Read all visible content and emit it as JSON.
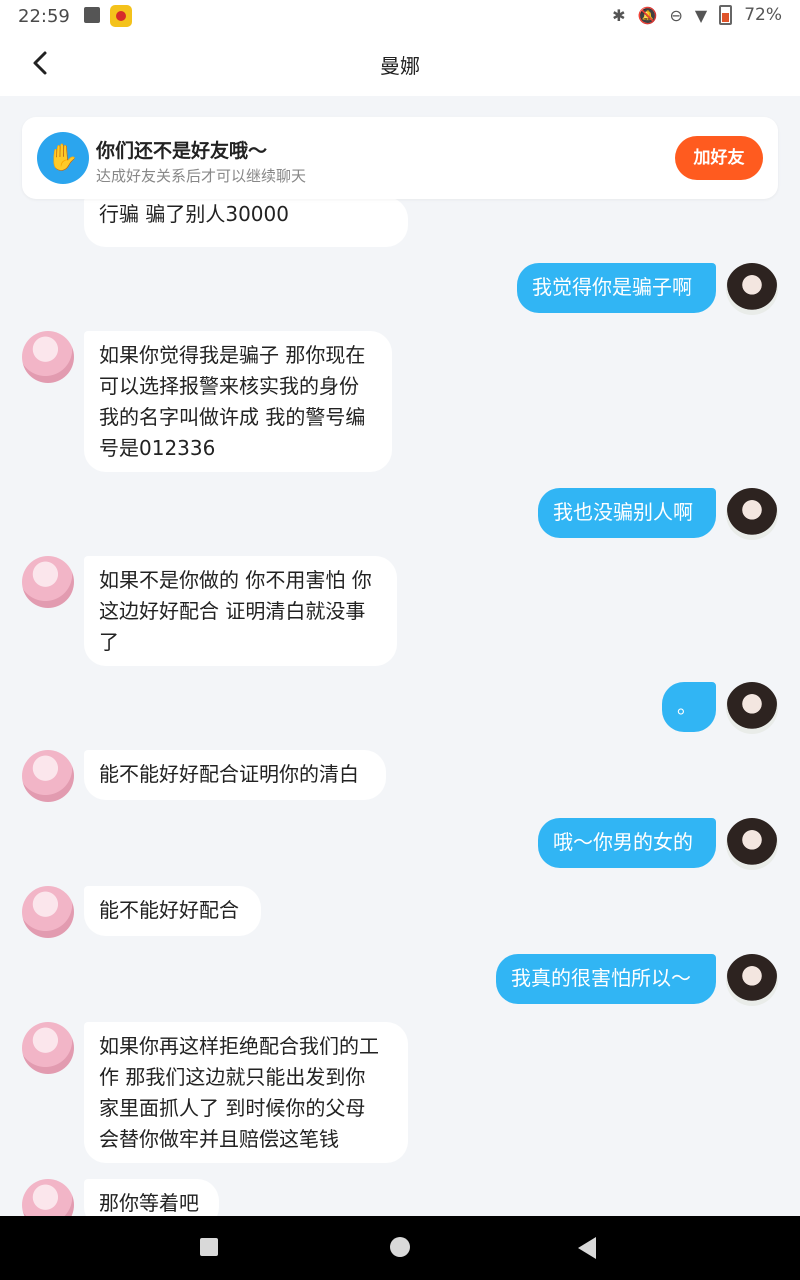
{
  "status_bar": {
    "time": "22:59",
    "battery": "72%"
  },
  "header": {
    "title": "曼娜"
  },
  "banner": {
    "title": "你们还不是好友哦～",
    "subtitle": "达成好友关系后才可以继续聊天",
    "add_button": "加好友"
  },
  "messages": [
    {
      "side": "left",
      "text": "行骗 骗了别人30000"
    },
    {
      "side": "right",
      "text": "我觉得你是骗子啊"
    },
    {
      "side": "left",
      "text": "如果你觉得我是骗子 那你现在\n可以选择报警来核实我的身份\n我的名字叫做许成 我的警号编\n号是012336"
    },
    {
      "side": "right",
      "text": "我也没骗别人啊"
    },
    {
      "side": "left",
      "text": "如果不是你做的 你不用害怕 你\n这边好好配合 证明清白就没事\n了"
    },
    {
      "side": "right",
      "text": "。"
    },
    {
      "side": "left",
      "text": "能不能好好配合证明你的清白"
    },
    {
      "side": "right",
      "text": "哦～你男的女的"
    },
    {
      "side": "left",
      "text": "能不能好好配合"
    },
    {
      "side": "right",
      "text": "我真的很害怕所以～"
    },
    {
      "side": "left",
      "text": "如果你再这样拒绝配合我们的工\n作 那我们这边就只能出发到你\n家里面抓人了 到时候你的父母\n会替你做牢并且赔偿这笔钱"
    },
    {
      "side": "left",
      "text": "那你等着吧"
    }
  ]
}
